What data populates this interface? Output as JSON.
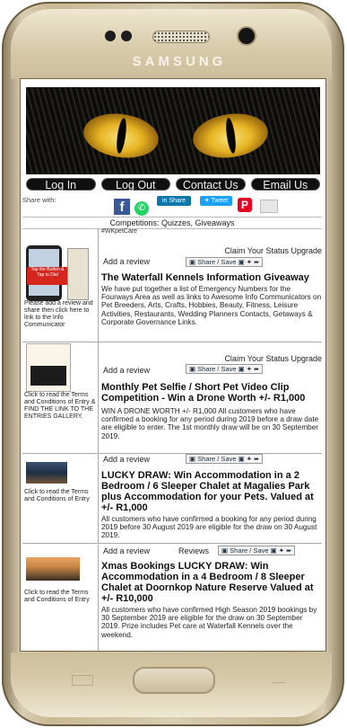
{
  "device": {
    "brand": "SAMSUNG"
  },
  "nav": {
    "login": "Log In",
    "logout": "Log Out",
    "contact": "Contact Us",
    "email": "Email Us"
  },
  "share": {
    "label": "Share with:",
    "linkedin": "Share",
    "twitter": "Tweet"
  },
  "competitions": {
    "heading": "Competitions: Quizzes, Giveaways"
  },
  "entries": [
    {
      "tag": "#WKpetCare",
      "top_note": "Claim Your Status Upgrade",
      "add_review": "Add a review",
      "share_save": "Share / Save",
      "thumb_text": "Tap the Button & Tap to Dial",
      "side_note": "Please add a review and share then click here to link to the Info Communicator",
      "title": "The Waterfall Kennels Information Giveaway",
      "desc": "We have put together a list of Emergency Numbers for the Fourways Area as well as links to Awesome Info Communicators on Pet Breeders, Arts, Crafts, Hobbies, Beauty, Fitness, Leisure Activities, Restaurants, Wedding Planners Contacts, Getaways & Corporate Governance Links."
    },
    {
      "top_note": "Claim Your Status Upgrade",
      "add_review": "Add a review",
      "share_save": "Share / Save",
      "side_note": "Click to read the Terms and Conditions of Entry & FIND THE LINK TO THE ENTRIES GALLERY.",
      "title": "Monthly Pet Selfie / Short Pet Video Clip Competition - Win a Drone Worth +/- R1,000",
      "desc": "WIN A DRONE WORTH +/- R1,000 All customers who have confirmed a booking for any period during 2019 before a draw date are eligible to enter. The 1st monthly draw will be on 30 September 2019."
    },
    {
      "add_review": "Add a review",
      "share_save": "Share / Save",
      "side_note": "Click to read the Terms and Conditions of Entry",
      "title": "LUCKY DRAW: Win Accommodation in a 2 Bedroom / 6 Sleeper Chalet at Magalies Park plus Accommodation for your Pets. Valued at +/- R1,000",
      "desc": "All customers who have confirmed a booking for any period during 2019 before 30 August 2019 are eligible for the draw on 30 August 2019."
    },
    {
      "add_review": "Add a review",
      "reviews": "Reviews",
      "share_save": "Share / Save",
      "side_note": "Click to read the Terms and Conditions of Entry",
      "title": "Xmas Bookings LUCKY DRAW: Win Accommodation in a 4 Bedroom / 8 Sleeper Chalet at Doornkop Nature Reserve Valued at +/- R10,000",
      "desc": "All customers who have confirmed High Season 2019 bookings by 30 September 2019 are eligible for the draw on 30 September 2019. Prize includes Pet care at Waterfall Kennels over the weekend."
    }
  ]
}
